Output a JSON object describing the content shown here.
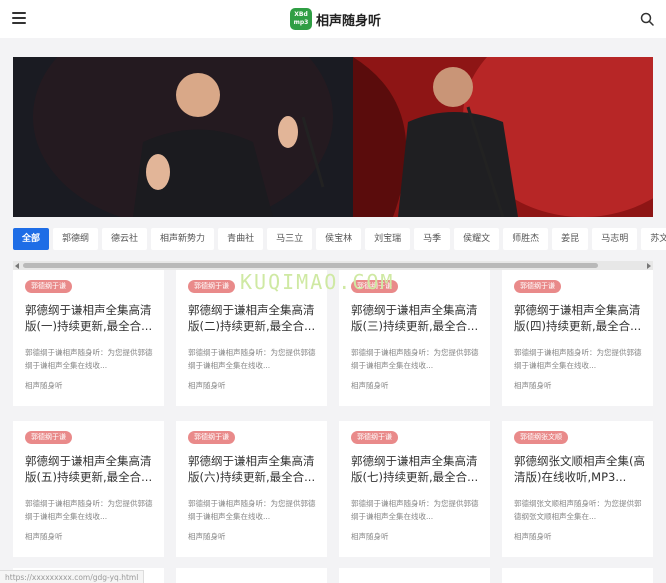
{
  "header": {
    "logo_mark": "XBd mp3",
    "site_name": "相声随身听"
  },
  "tabs": [
    {
      "label": "全部",
      "active": true
    },
    {
      "label": "郭德纲"
    },
    {
      "label": "德云社"
    },
    {
      "label": "相声新势力"
    },
    {
      "label": "青曲社"
    },
    {
      "label": "马三立"
    },
    {
      "label": "侯宝林"
    },
    {
      "label": "刘宝瑞"
    },
    {
      "label": "马季"
    },
    {
      "label": "侯耀文"
    },
    {
      "label": "师胜杰"
    },
    {
      "label": "姜昆"
    },
    {
      "label": "马志明"
    },
    {
      "label": "苏文茂"
    }
  ],
  "cards": [
    {
      "badge": "郭德纲于谦",
      "title": "郭德纲于谦相声全集高清版(一)持续更新,最全合...",
      "desc": "郭德纲于谦相声随身听：为您提供郭德纲于谦相声全集在线收...",
      "source": "相声随身听"
    },
    {
      "badge": "郭德纲于谦",
      "title": "郭德纲于谦相声全集高清版(二)持续更新,最全合...",
      "desc": "郭德纲于谦相声随身听：为您提供郭德纲于谦相声全集在线收...",
      "source": "相声随身听"
    },
    {
      "badge": "郭德纲于谦",
      "title": "郭德纲于谦相声全集高清版(三)持续更新,最全合...",
      "desc": "郭德纲于谦相声随身听：为您提供郭德纲于谦相声全集在线收...",
      "source": "相声随身听"
    },
    {
      "badge": "郭德纲于谦",
      "title": "郭德纲于谦相声全集高清版(四)持续更新,最全合...",
      "desc": "郭德纲于谦相声随身听：为您提供郭德纲于谦相声全集在线收...",
      "source": "相声随身听"
    },
    {
      "badge": "郭德纲于谦",
      "title": "郭德纲于谦相声全集高清版(五)持续更新,最全合...",
      "desc": "郭德纲于谦相声随身听：为您提供郭德纲于谦相声全集在线收...",
      "source": "相声随身听"
    },
    {
      "badge": "郭德纲于谦",
      "title": "郭德纲于谦相声全集高清版(六)持续更新,最全合...",
      "desc": "郭德纲于谦相声随身听：为您提供郭德纲于谦相声全集在线收...",
      "source": "相声随身听"
    },
    {
      "badge": "郭德纲于谦",
      "title": "郭德纲于谦相声全集高清版(七)持续更新,最全合...",
      "desc": "郭德纲于谦相声随身听：为您提供郭德纲于谦相声全集在线收...",
      "source": "相声随身听"
    },
    {
      "badge": "郭德纲张文顺",
      "title": "郭德纲张文顺相声全集(高清版)在线收听,MP3...",
      "desc": "郭德纲张文顺相声随身听：为您提供郭德纲张文顺相声全集在...",
      "source": "相声随身听"
    }
  ],
  "watermark": "KUQIMAO.COM",
  "status_url": "https://xxxxxxxxx.com/gdg-yq.html",
  "colors": {
    "accent": "#1e6de6",
    "badge": "#e98a8a",
    "logo": "#2f9e44"
  }
}
